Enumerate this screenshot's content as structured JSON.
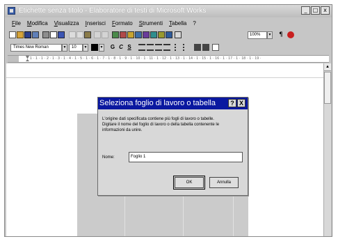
{
  "window": {
    "title": "Etichette senza titolo - Elaboratore di testi di Microsoft Works",
    "buttons": {
      "minimize": "_",
      "restore": "□",
      "close": "x"
    }
  },
  "menu": [
    "File",
    "Modifica",
    "Visualizza",
    "Inserisci",
    "Formato",
    "Strumenti",
    "Tabella",
    "?"
  ],
  "toolbar": {
    "zoom": "100%",
    "font_name": "Times New Roman",
    "font_size": "10",
    "bold_label": "G",
    "italic_label": "C",
    "underline_label": "S"
  },
  "ruler": {
    "text": "1 · 1 · 1 · 2 · 1 · 3 · 1 · 4 · 1 · 5 · 1 · 6 · 1 · 7 · 1 · 8 · 1 · 9 · 1 · 10 · 1 · 11 · 1 · 12 · 1 · 13 · 1 · 14 · 1 · 15 · 1 · 16 · 1 · 17 · 1 · 18 · 1 · 19 ·"
  },
  "dialog": {
    "title": "Seleziona foglio di lavoro o tabella",
    "help_button": "?",
    "close_button": "X",
    "message_lines": [
      "L'origine dati specificata contiene più fogli di lavoro o tabelle.",
      "Digitare il nome del foglio di lavoro o della tabella contenente le",
      "informazioni da unire."
    ],
    "name_label": "Nome:",
    "name_value": "Foglio 1",
    "ok_label": "OK",
    "cancel_label": "Annulla"
  },
  "colors": {
    "dialog_title_bg": "#0a18a0",
    "window_bg": "#c6c6c6"
  }
}
